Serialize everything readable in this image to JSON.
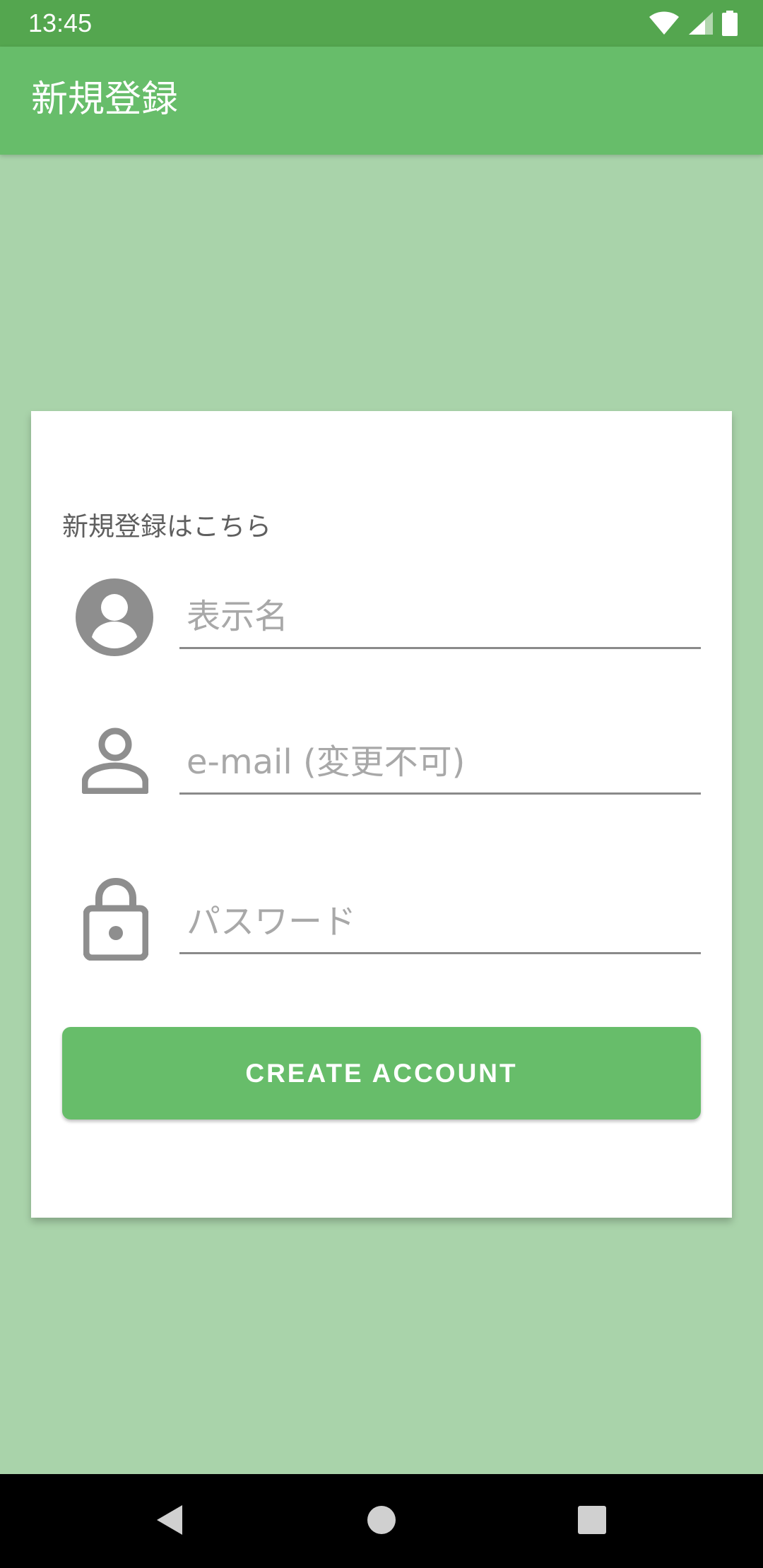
{
  "status_bar": {
    "time": "13:45",
    "icons": [
      "wifi-icon",
      "cell-signal-icon",
      "battery-icon"
    ]
  },
  "app_bar": {
    "title": "新規登録"
  },
  "form": {
    "heading": "新規登録はこちら",
    "display_name": {
      "placeholder": "表示名",
      "icon": "account-circle-icon"
    },
    "email": {
      "placeholder": "e-mail (変更不可)",
      "icon": "person-outline-icon"
    },
    "password": {
      "placeholder": "パスワード",
      "icon": "lock-icon"
    },
    "submit_label": "CREATE ACCOUNT"
  },
  "nav_bar": {
    "buttons": [
      "back-icon",
      "home-icon",
      "recents-icon"
    ]
  },
  "colors": {
    "status_bar": "#54a64f",
    "app_bar": "#67bd6a",
    "background": "#a9d3aa",
    "button": "#67bd6a",
    "icon_gray": "#8e8e8e"
  }
}
